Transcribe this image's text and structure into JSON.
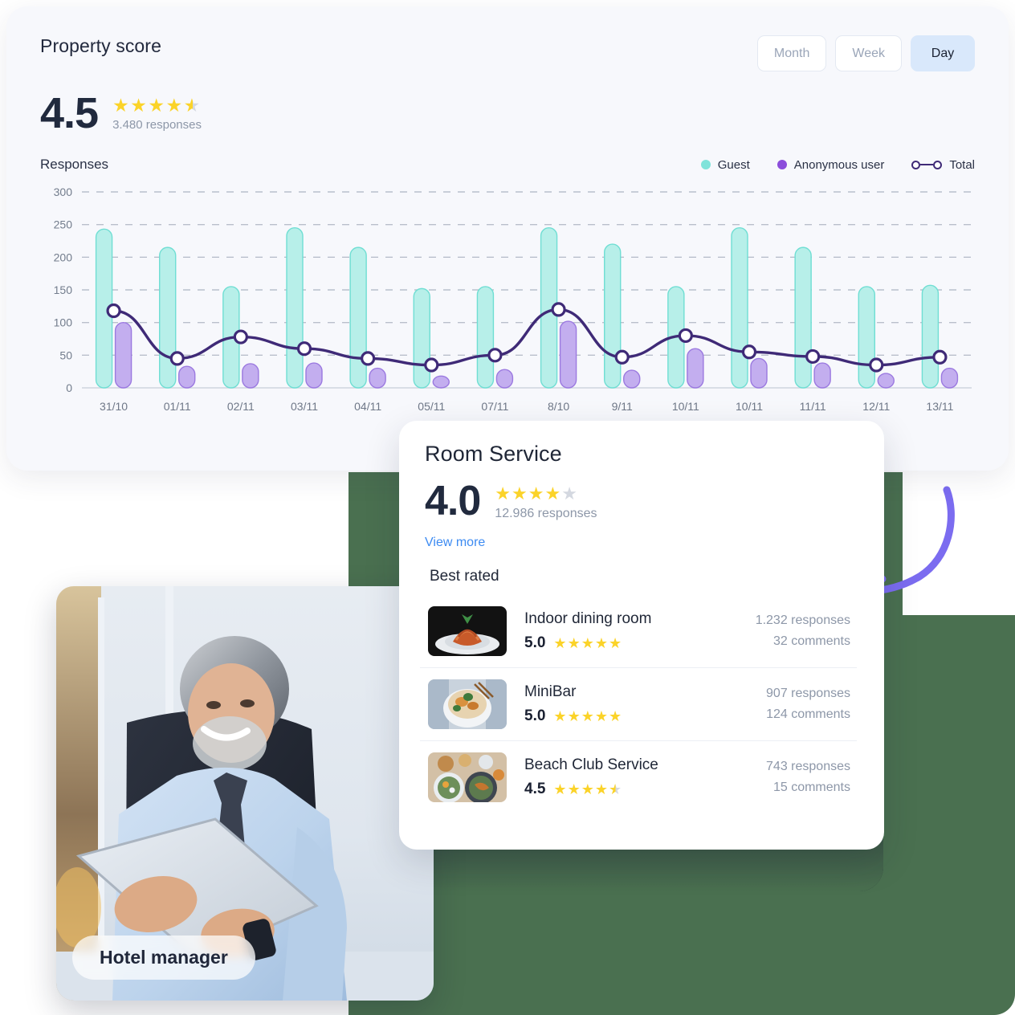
{
  "dashboard": {
    "title": "Property score",
    "range_buttons": [
      {
        "label": "Month",
        "active": false
      },
      {
        "label": "Week",
        "active": false
      },
      {
        "label": "Day",
        "active": true
      }
    ],
    "score": "4.5",
    "score_stars": 4.5,
    "responses": "3.480 responses",
    "responses_label": "Responses",
    "legend": [
      {
        "label": "Guest",
        "color": "#7fe3da",
        "type": "dot"
      },
      {
        "label": "Anonymous user",
        "color": "#8b4ddb",
        "type": "dot"
      },
      {
        "label": "Total",
        "color": "#3f2a77",
        "type": "line"
      }
    ]
  },
  "chart_data": {
    "type": "bar",
    "title": "Responses",
    "xlabel": "",
    "ylabel": "",
    "ylim": [
      0,
      300
    ],
    "yticks": [
      0,
      50,
      100,
      150,
      200,
      250,
      300
    ],
    "grid": true,
    "legend_position": "top-right",
    "categories": [
      "31/10",
      "01/11",
      "02/11",
      "03/11",
      "04/11",
      "05/11",
      "07/11",
      "8/10",
      "9/11",
      "10/11",
      "10/11",
      "11/11",
      "12/11",
      "13/11"
    ],
    "series": [
      {
        "name": "Guest",
        "type": "bar",
        "color": "#a9ece6",
        "values": [
          243,
          215,
          155,
          245,
          215,
          152,
          155,
          245,
          220,
          155,
          245,
          215,
          155,
          157
        ]
      },
      {
        "name": "Anonymous user",
        "type": "bar",
        "color": "#bfaaef",
        "values": [
          100,
          33,
          37,
          38,
          30,
          18,
          28,
          102,
          27,
          60,
          45,
          38,
          22,
          30
        ]
      },
      {
        "name": "Total",
        "type": "line",
        "color": "#3f2a77",
        "values": [
          118,
          45,
          78,
          60,
          45,
          35,
          50,
          120,
          47,
          80,
          55,
          48,
          35,
          47
        ]
      }
    ]
  },
  "room_service": {
    "title": "Room Service",
    "score": "4.0",
    "score_stars": 4,
    "responses": "12.986 responses",
    "view_more": "View more",
    "best_rated_label": "Best rated",
    "items": [
      {
        "name": "Indoor dining room",
        "rating": "5.0",
        "stars": 5,
        "responses": "1.232 responses",
        "comments": "32 comments",
        "thumb": "pasta-photo"
      },
      {
        "name": "MiniBar",
        "rating": "5.0",
        "stars": 5,
        "responses": "907 responses",
        "comments": "124 comments",
        "thumb": "bowl-photo"
      },
      {
        "name": "Beach Club Service",
        "rating": "4.5",
        "stars": 4.5,
        "responses": "743 responses",
        "comments": "15 comments",
        "thumb": "platter-photo"
      }
    ]
  },
  "photo": {
    "badge": "Hotel manager",
    "alt": "hotel-manager-photo"
  },
  "colors": {
    "green_bg": "#4a7050",
    "dark_panel": "#1c1f2e",
    "accent_blue": "#3d8bf2",
    "star_gold": "#fbd329",
    "guest": "#7fe3da",
    "anonymous": "#8b4ddb",
    "total": "#3f2a77",
    "arrow": "#7b6cf0"
  }
}
